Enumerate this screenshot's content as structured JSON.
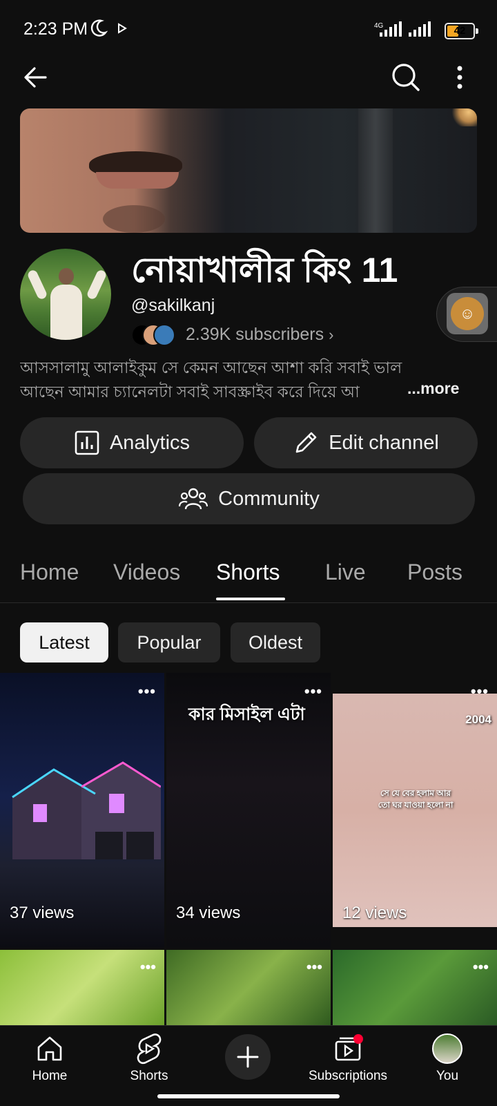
{
  "status": {
    "time": "2:23 PM",
    "network": "4G",
    "battery": "42"
  },
  "channel": {
    "title": "নোয়াখালীর কিং 11",
    "handle": "@sakilkanj",
    "subscribers": "2.39K subscribers",
    "description_line1": "আসসালামু আলাইকুম সে কেমন আছেন আশা করি সবাই ভাল",
    "description_line2": "আছেন আমার চ্যানেলটা সবাই সাবস্ক্রাইব করে দিয়ে আ",
    "more": "...more"
  },
  "buttons": {
    "analytics": "Analytics",
    "edit": "Edit channel",
    "community": "Community"
  },
  "tabs": [
    "Home",
    "Videos",
    "Shorts",
    "Live",
    "Posts"
  ],
  "active_tab": "Shorts",
  "filters": [
    "Latest",
    "Popular",
    "Oldest"
  ],
  "selected_filter": "Latest",
  "shorts": [
    {
      "views": "37 views",
      "overlay": ""
    },
    {
      "views": "34 views",
      "overlay": "কার মিসাইল এটা"
    },
    {
      "views": "12 views",
      "overlay": "সে যে বের হলাম আর তো ঘর যাওয়া হলো না",
      "badge": "2004"
    }
  ],
  "nav": {
    "home": "Home",
    "shorts": "Shorts",
    "subscriptions": "Subscriptions",
    "you": "You"
  },
  "colors": {
    "background": "#0f0f0f",
    "button": "#272727",
    "badge": "#ff0033"
  }
}
